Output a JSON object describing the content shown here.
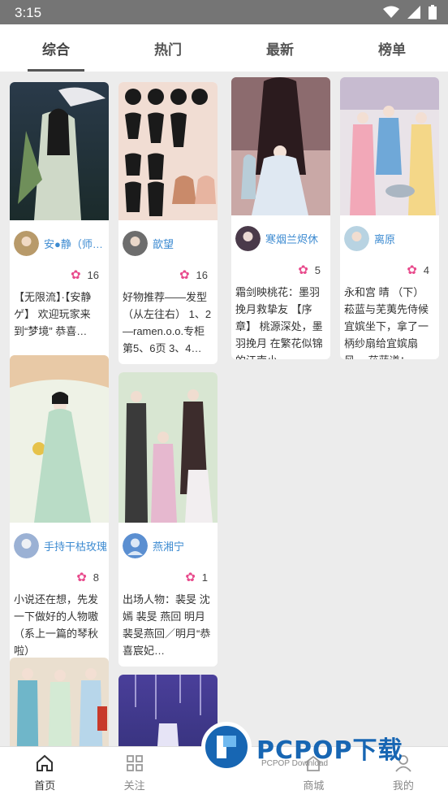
{
  "status": {
    "time": "3:15"
  },
  "tabs": [
    {
      "label": "综合"
    },
    {
      "label": "热门"
    },
    {
      "label": "最新"
    },
    {
      "label": "榜单"
    }
  ],
  "cards": [
    {
      "author": "安●静（师：…",
      "likes": "16",
      "desc": "【无限流】·【安静ゲ】 欢迎玩家来到“梦境” 恭喜…"
    },
    {
      "author": "歆望",
      "likes": "16",
      "desc": "好物推荐——发型（从左往右） 1、2—ramen.o.o.专柜第5、6页 3、4…"
    },
    {
      "author": "寒烟兰烬休",
      "likes": "5",
      "desc": "霜剑映桃花：墨羽挽月救挚友 【序章】 桃源深处，墨羽挽月 在繁花似锦的江南小…"
    },
    {
      "author": "离原",
      "likes": "4",
      "desc": "永和宫 晴 （下） 菘蓝与芜荑先侍候宜嫔坐下，拿了一柄纱扇给宜嫔扇风。 菘蓝道：…"
    },
    {
      "author": "手持干枯玫瑰",
      "likes": "8",
      "desc": "小说还在想，先发一下做好的人物嗷（系上一篇的琴秋啦）"
    },
    {
      "author": "燕湘宁",
      "likes": "1",
      "desc": "出场人物：裴旻 沈嫣 裴旻 燕回 明月 裴旻燕回／明月“恭喜宸妃…"
    }
  ],
  "bottom_nav": [
    {
      "label": "首页"
    },
    {
      "label": "关注"
    },
    {
      "label": ""
    },
    {
      "label": "商城"
    },
    {
      "label": "我的"
    }
  ],
  "watermark": {
    "title": "PCPOP下载",
    "subtitle": "PCPOP Download"
  },
  "colors": {
    "accent": "#3d8bd1",
    "flower": "#e84a8c",
    "status_bar": "#757575"
  }
}
